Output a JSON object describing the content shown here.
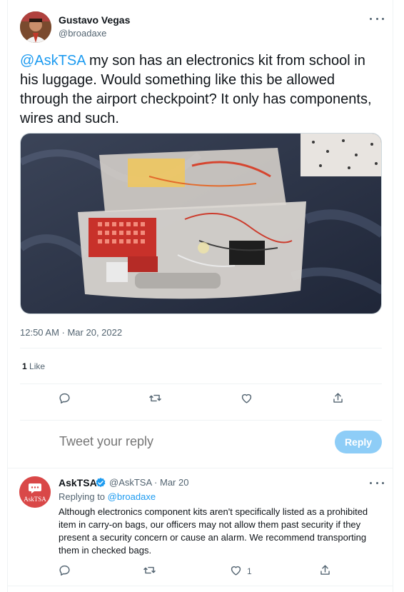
{
  "tweet": {
    "author_name": "Gustavo Vegas",
    "author_handle": "@broadaxe",
    "mention": "@AskTSA",
    "text": " my son has an electronics kit from school in his luggage. Would something like this be allowed through the airport checkpoint? It only has components, wires and such.",
    "timestamp": "12:50 AM · Mar 20, 2022",
    "likes_count": "1",
    "likes_label": "Like"
  },
  "actions": {
    "icons": [
      "reply-icon",
      "retweet-icon",
      "like-icon",
      "share-icon"
    ]
  },
  "composer": {
    "placeholder": "Tweet your reply",
    "reply_button": "Reply"
  },
  "reply": {
    "author_name": "AskTSA",
    "avatar_text": "AskTSA",
    "handle_date": "@AskTSA · Mar 20",
    "replying_prefix": "Replying to ",
    "replying_to": "@broadaxe",
    "text": "Although electronics component kits aren't specifically listed as a prohibited item in carry-on bags, our officers may not allow them past security if they present a security concern or cause an alarm. We recommend transporting them in checked bags.",
    "like_count": "1"
  },
  "colors": {
    "accent": "#1d9bf0",
    "reply_button_disabled": "#8ecdf7",
    "muted_text": "#536471",
    "tsa_avatar": "#d94848"
  }
}
